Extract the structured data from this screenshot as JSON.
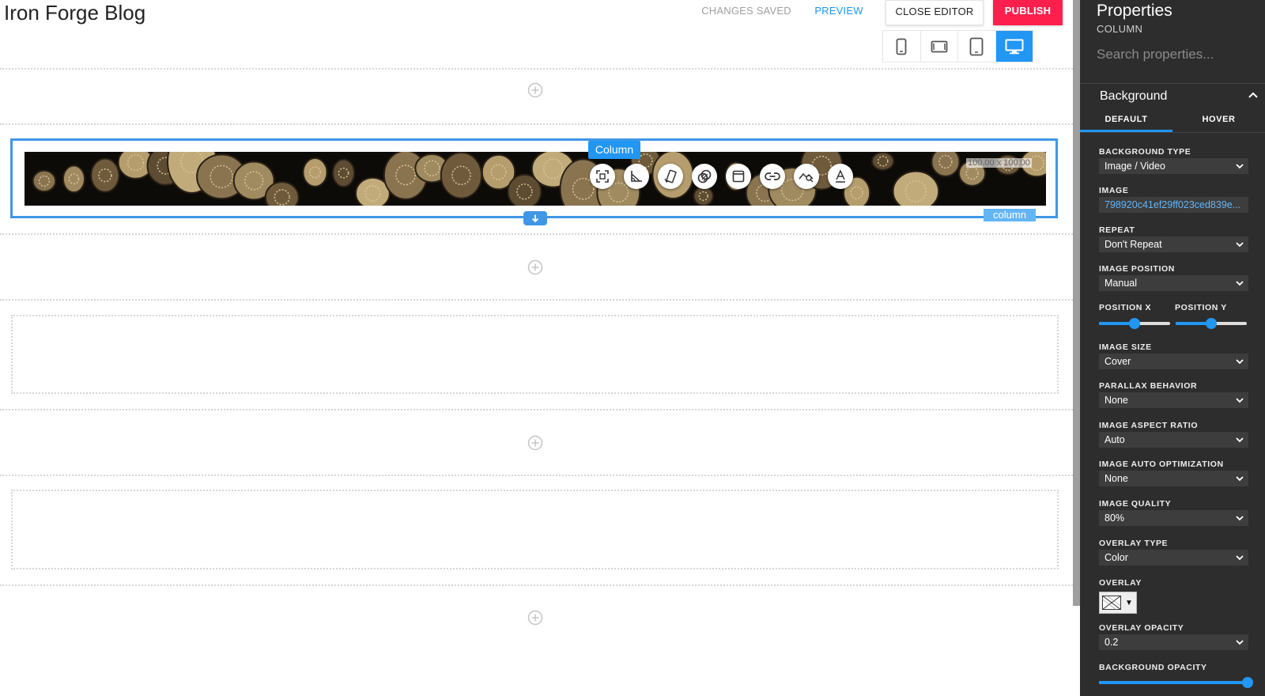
{
  "header": {
    "title": "Iron Forge Blog",
    "changes_saved": "CHANGES SAVED",
    "preview": "PREVIEW",
    "close_editor": "CLOSE EDITOR",
    "publish": "PUBLISH",
    "devices": [
      "phone-icon",
      "phone-landscape-icon",
      "tablet-icon",
      "desktop-icon"
    ],
    "active_device": "desktop"
  },
  "canvas": {
    "selected_column": {
      "label": "Column",
      "tag": "column",
      "size": "100.00 x 100.00",
      "tools": [
        "crop-icon",
        "angle-icon",
        "resize-icon",
        "layers-icon",
        "window-icon",
        "link-icon",
        "search-image-icon",
        "text-icon"
      ]
    }
  },
  "properties": {
    "title": "Properties",
    "subtitle": "COLUMN",
    "search_placeholder": "Search properties...",
    "section": "Background",
    "tabs": [
      "DEFAULT",
      "HOVER"
    ],
    "active_tab": "DEFAULT",
    "fields": {
      "background_type": {
        "label": "BACKGROUND TYPE",
        "value": "Image / Video"
      },
      "image": {
        "label": "IMAGE",
        "value": "798920c41ef29ff023ced839e..."
      },
      "repeat": {
        "label": "REPEAT",
        "value": "Don't Repeat"
      },
      "image_position": {
        "label": "IMAGE POSITION",
        "value": "Manual"
      },
      "position_x": {
        "label": "POSITION X",
        "value": 0.5
      },
      "position_y": {
        "label": "POSITION Y",
        "value": 0.5
      },
      "image_size": {
        "label": "IMAGE SIZE",
        "value": "Cover"
      },
      "parallax": {
        "label": "PARALLAX BEHAVIOR",
        "value": "None"
      },
      "aspect_ratio": {
        "label": "IMAGE ASPECT RATIO",
        "value": "Auto"
      },
      "auto_optimization": {
        "label": "IMAGE AUTO OPTIMIZATION",
        "value": "None"
      },
      "image_quality": {
        "label": "IMAGE QUALITY",
        "value": "80%"
      },
      "overlay_type": {
        "label": "OVERLAY TYPE",
        "value": "Color"
      },
      "overlay": {
        "label": "OVERLAY"
      },
      "overlay_opacity": {
        "label": "OVERLAY OPACITY",
        "value": "0.2"
      },
      "background_opacity": {
        "label": "BACKGROUND OPACITY",
        "value": 1.0
      }
    }
  },
  "colors": {
    "accent": "#2196f3",
    "publish": "#ff1f4d",
    "panel_bg": "#2d2d2d",
    "selection": "#3f97e6"
  }
}
